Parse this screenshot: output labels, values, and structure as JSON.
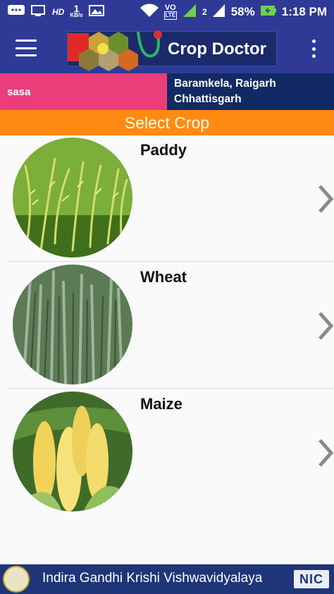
{
  "status_bar": {
    "network_type": "HD",
    "data_speed_value": "1",
    "data_speed_unit": "KB/s",
    "volte_label": "VO",
    "lte_label": "LTE",
    "sim_slot_label": "2",
    "battery_percent": "58%",
    "time": "1:18 PM",
    "icons": [
      "chat-icon",
      "screen-icon",
      "image-icon",
      "wifi-icon",
      "signal-icon",
      "battery-icon"
    ]
  },
  "app_bar": {
    "title": "Crop Doctor",
    "menu_icon": "hamburger-menu-icon",
    "overflow_icon": "more-vert-icon"
  },
  "user": {
    "name": "sasa",
    "location_line1": "Baramkela, Raigarh",
    "location_line2": "Chhattisgarh"
  },
  "section": {
    "title": "Select Crop"
  },
  "crops": [
    {
      "name": "Paddy",
      "image": "paddy-photo"
    },
    {
      "name": "Wheat",
      "image": "wheat-photo"
    },
    {
      "name": "Maize",
      "image": "maize-photo"
    }
  ],
  "footer": {
    "university": "Indira Gandhi Krishi Vishwavidyalaya",
    "nic_label": "NIC"
  },
  "colors": {
    "primary": "#2f3a96",
    "pink": "#ea3d7a",
    "navy": "#122a63",
    "orange": "#ff8a12",
    "footer": "#1e3578"
  }
}
